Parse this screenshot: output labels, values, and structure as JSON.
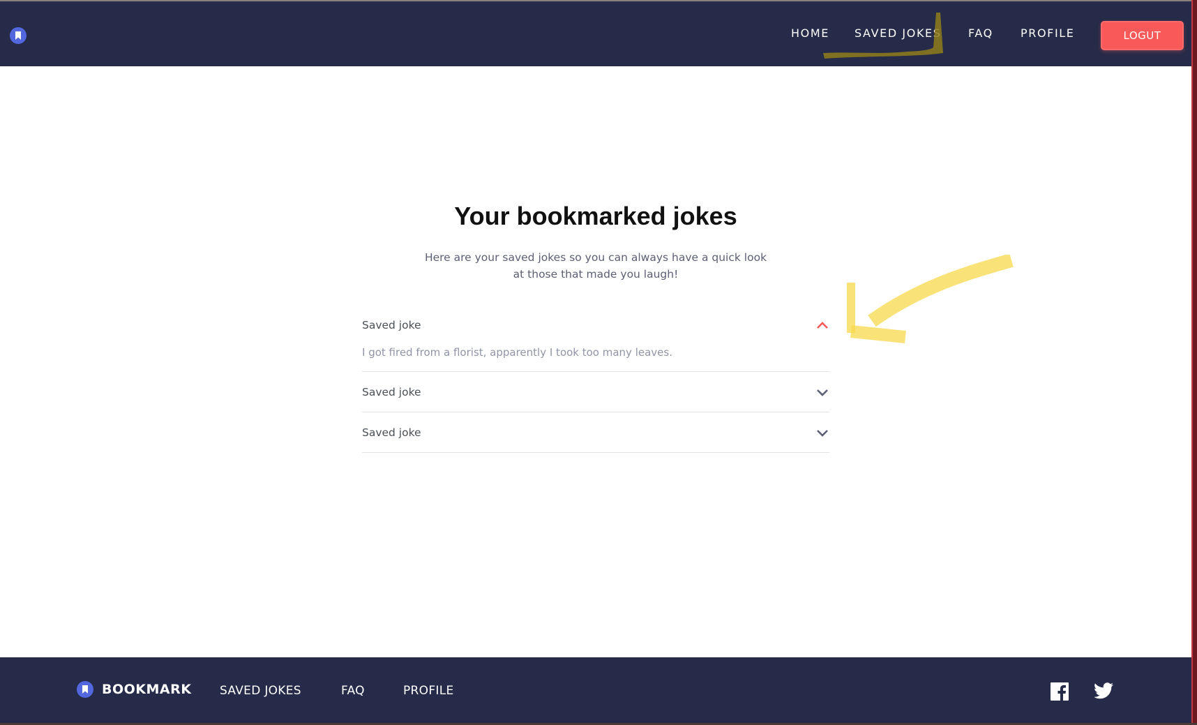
{
  "header": {
    "nav": {
      "home": "HOME",
      "saved_jokes": "SAVED JOKES",
      "faq": "FAQ",
      "profile": "PROFILE"
    },
    "logout_label": "LOGUT"
  },
  "main": {
    "title": "Your bookmarked jokes",
    "subtitle_line1": "Here are your saved jokes so you can always have a quick look",
    "subtitle_line2": "at those that made you laugh!",
    "jokes": [
      {
        "label": "Saved joke",
        "expanded": true,
        "text": "I got fired from a florist, apparently I took too many leaves."
      },
      {
        "label": "Saved joke",
        "expanded": false
      },
      {
        "label": "Saved joke",
        "expanded": false
      }
    ]
  },
  "footer": {
    "brand": "BOOKMARK",
    "links": {
      "saved_jokes": "SAVED JOKES",
      "faq": "FAQ",
      "profile": "PROFILE"
    },
    "social": [
      "facebook-icon",
      "twitter-icon"
    ]
  },
  "colors": {
    "navy": "#252b48",
    "accent_red": "#fa5959",
    "brand_blue": "#5368df",
    "highlighter": "#f7d94c"
  }
}
